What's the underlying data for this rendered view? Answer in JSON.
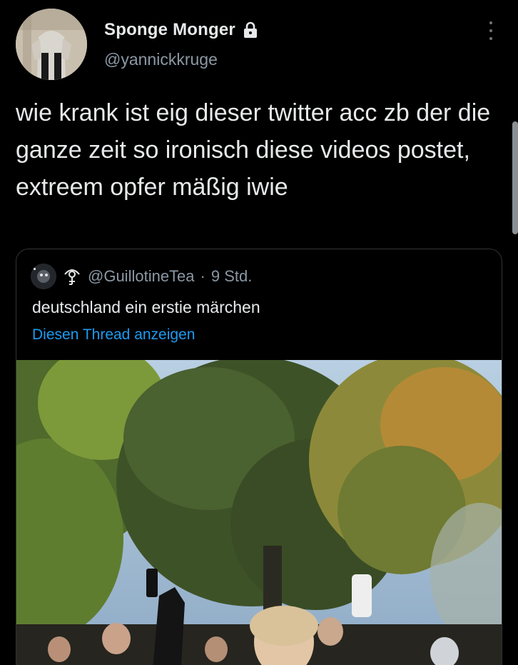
{
  "author": {
    "name": "Sponge Monger",
    "handle": "@yannickkruge",
    "protected_icon": "lock-icon"
  },
  "tweet": {
    "text": "wie krank ist eig dieser twitter acc zb der die ganze zeit so ironisch diese videos postet, extreem opfer mäßig iwie"
  },
  "quote": {
    "handle": "@GuillotineTea",
    "separator": "·",
    "time": "9 Std.",
    "text": "deutschland ein erstie märchen",
    "thread_link": "Diesen Thread anzeigen",
    "media": "video-thumbnail-trees-crowd"
  },
  "colors": {
    "background": "#000000",
    "text": "#e7e9ea",
    "secondary": "#8b98a5",
    "link": "#1d9bf0",
    "border": "#2f3336"
  }
}
